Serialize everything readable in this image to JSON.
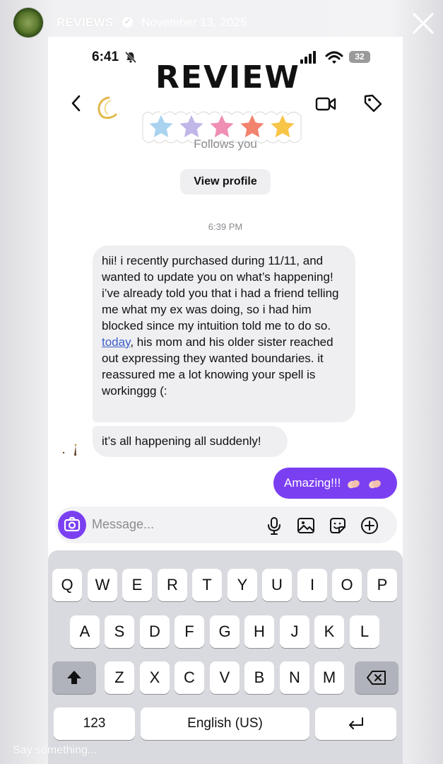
{
  "story": {
    "name": "REVIEWS",
    "verified": "✓",
    "date": "November 13, 2025",
    "footer_placeholder": "Say something..."
  },
  "phone": {
    "time": "6:41",
    "battery": "32",
    "follows_text": "Follows you",
    "view_profile_label": "View profile",
    "timestamp": "6:39 PM"
  },
  "sticker": {
    "title": "REVIEW",
    "star_colors": [
      "#a9d3ef",
      "#c3b6e8",
      "#ef8fb4",
      "#f2836f",
      "#f7c548"
    ]
  },
  "messages": {
    "incoming_1_before": "hii! i recently purchased during 11/11, and wanted to update you on what’s happening! i’ve already told you that i had a friend telling me what my ex was doing, so i had him blocked since my intuition told me to do so. ",
    "incoming_1_link": "today",
    "incoming_1_after": ", his mom and his older sister reached out expressing they wanted boundaries. it reassured me a lot knowing your spell is workinggg (:",
    "incoming_2": "it’s all happening all suddenly!",
    "outgoing_1": "Amazing!!!"
  },
  "composer": {
    "placeholder": "Message...",
    "icons": [
      "camera-icon",
      "microphone-icon",
      "gallery-icon",
      "sticker-icon",
      "add-icon"
    ]
  },
  "keyboard": {
    "row1": [
      "Q",
      "W",
      "E",
      "R",
      "T",
      "Y",
      "U",
      "I",
      "O",
      "P"
    ],
    "row2": [
      "A",
      "S",
      "D",
      "F",
      "G",
      "H",
      "J",
      "K",
      "L"
    ],
    "row3": [
      "Z",
      "X",
      "C",
      "V",
      "B",
      "N",
      "M"
    ],
    "numbers_label": "123",
    "space_label": "English (US)"
  },
  "colors": {
    "accent": "#7b3ff2",
    "link": "#3b5fc9",
    "bubble_gray": "#efeff2"
  }
}
